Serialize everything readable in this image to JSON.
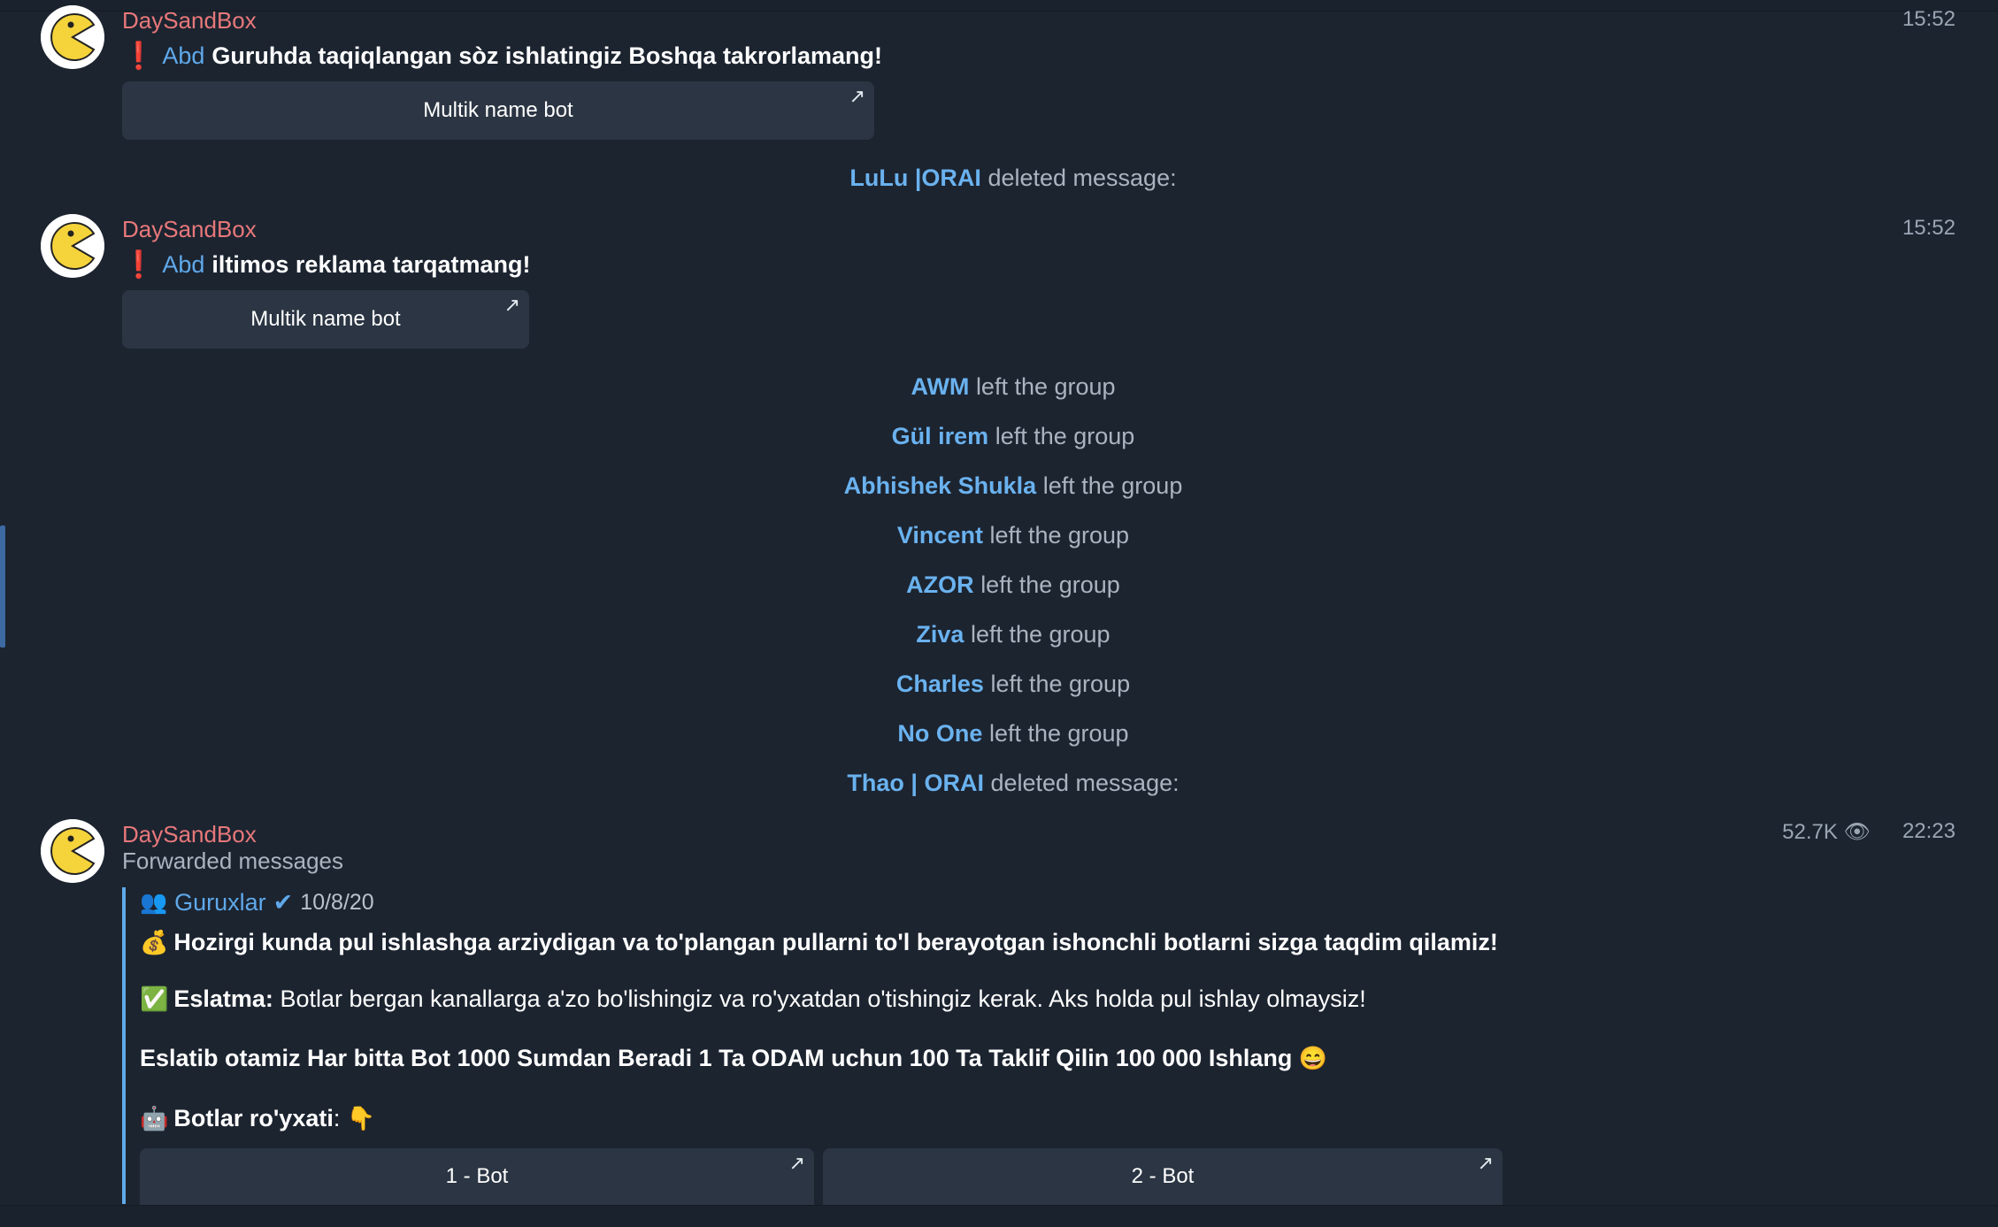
{
  "messages": [
    {
      "sender": "DaySandBox",
      "time": "15:52",
      "warn": "❗",
      "mention": "Abd",
      "text": "Guruhda taqiqlangan sòz ishlatingiz Boshqa takrorlamang!",
      "button": "Multik name bot"
    },
    {
      "sender": "DaySandBox",
      "time": "15:52",
      "warn": "❗",
      "mention": "Abd",
      "text": "iltimos reklama tarqatmang!",
      "button": "Multik name bot"
    }
  ],
  "service": [
    {
      "name": "LuLu |ORAI",
      "action": "deleted message:"
    },
    {
      "name": "AWM",
      "action": "left the group"
    },
    {
      "name": "Gül irem",
      "action": "left the group"
    },
    {
      "name": "Abhishek Shukla",
      "action": "left the group"
    },
    {
      "name": "Vincent",
      "action": "left the group"
    },
    {
      "name": "AZOR",
      "action": "left the group"
    },
    {
      "name": "Ziva",
      "action": "left the group"
    },
    {
      "name": "Charles",
      "action": "left the group"
    },
    {
      "name": "No One",
      "action": "left the group"
    },
    {
      "name": "Thao | ORAI",
      "action": "deleted message:"
    }
  ],
  "forwarded": {
    "sender": "DaySandBox",
    "label": "Forwarded messages",
    "views": "52.7K",
    "time": "22:23",
    "channel_emoji": "👥",
    "channel": "Guruxlar",
    "verified": "✔",
    "date": "10/8/20",
    "line1_emoji": "💰",
    "line1": "Hozirgi kunda pul ishlashga arziydigan va to'plangan pullarni to'l berayotgan ishonchli botlarni sizga taqdim qilamiz!",
    "line2_emoji": "✅",
    "line2_bold": "Eslatma:",
    "line2": "Botlar bergan kanallarga a'zo bo'lishingiz va ro'yxatdan o'tishingiz kerak. Aks holda pul ishlay olmaysiz!",
    "line3": "Eslatib otamiz Har bitta Bot 1000 Sumdan Beradi 1 Ta ODAM uchun 100 Ta Taklif Qilin 100 000 Ishlang",
    "line3_emoji": "😄",
    "line4_emoji": "🤖",
    "line4_bold": "Botlar ro'yxati",
    "line4_rest": ":",
    "line4_end_emoji": "👇",
    "buttons": [
      "1 - Bot",
      "2 - Bot"
    ]
  },
  "icons": {
    "avatar": "pacman-avatar",
    "open_link": "arrow-up-right-icon",
    "views": "eye-icon"
  },
  "colors": {
    "background": "#1c2430",
    "sender": "#e8787a",
    "link": "#5fa9ea",
    "button": "#2b3543"
  }
}
